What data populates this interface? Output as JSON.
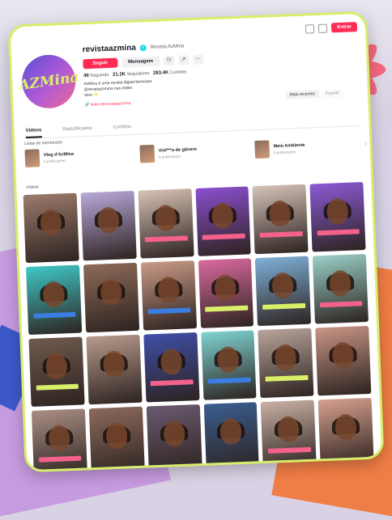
{
  "header": {
    "login_label": "Entrar"
  },
  "profile": {
    "avatar_mark": "AZMina",
    "username": "revistaazmina",
    "display_name": "Revista AzMina",
    "follow_label": "Seguir",
    "message_label": "Mensagem",
    "following_count": "49",
    "following_label": "Seguindo",
    "followers_count": "21.2K",
    "followers_label": "Seguidores",
    "likes_count": "283.4K",
    "likes_label": "Curtidas",
    "bio_line1": "AzMina é uma revista digital feminista",
    "bio_line2": "@revistaazmina nas redes",
    "bio_line3": "Vem ✨",
    "link_text": "🔗 linktr.ee/revistaazmina"
  },
  "sort": {
    "option1": "Mais recentes",
    "option2": "Popular"
  },
  "tabs": [
    {
      "label": "Vídeos"
    },
    {
      "label": "Republicados"
    },
    {
      "label": "Curtidos"
    }
  ],
  "playlists": {
    "section_label": "Listas de reprodução",
    "items": [
      {
        "title": "Vlog d'AzMina",
        "count": "6 publicações"
      },
      {
        "title": "Viol***a de gênero",
        "count": "8 publicações"
      },
      {
        "title": "Meio Ambiente",
        "count": "5 publicações"
      }
    ]
  },
  "grid": {
    "section_label": "Vídeos",
    "tiles": [
      {
        "bg": "#9b7a6b",
        "caption": "none"
      },
      {
        "bg": "#b8a9d9",
        "caption": "none"
      },
      {
        "bg": "#d7c2b5",
        "caption": "pink"
      },
      {
        "bg": "#8b4fcf",
        "caption": "pink"
      },
      {
        "bg": "#d5c3b8",
        "caption": "pink"
      },
      {
        "bg": "#8a5ad6",
        "caption": "pink"
      },
      {
        "bg": "#3fc7c7",
        "caption": "blue"
      },
      {
        "bg": "#8d6a58",
        "caption": "none"
      },
      {
        "bg": "#c99a86",
        "caption": "blue"
      },
      {
        "bg": "#d96a9e",
        "caption": "alt"
      },
      {
        "bg": "#7fb0d8",
        "caption": "alt"
      },
      {
        "bg": "#9ad0c7",
        "caption": "pink"
      },
      {
        "bg": "#6f5a4e",
        "caption": "alt"
      },
      {
        "bg": "#b79a8c",
        "caption": "none"
      },
      {
        "bg": "#3e4fa7",
        "caption": "pink"
      },
      {
        "bg": "#7fd3d3",
        "caption": "blue"
      },
      {
        "bg": "#b8a49a",
        "caption": "alt"
      },
      {
        "bg": "#c89585",
        "caption": "none"
      },
      {
        "bg": "#a98e84",
        "caption": "pink"
      },
      {
        "bg": "#8c6a5c",
        "caption": "none"
      },
      {
        "bg": "#6a5a70",
        "caption": "none"
      },
      {
        "bg": "#3a5d8f",
        "caption": "none"
      },
      {
        "bg": "#c9b0a5",
        "caption": "pink"
      },
      {
        "bg": "#d6a08e",
        "caption": "none"
      }
    ]
  }
}
